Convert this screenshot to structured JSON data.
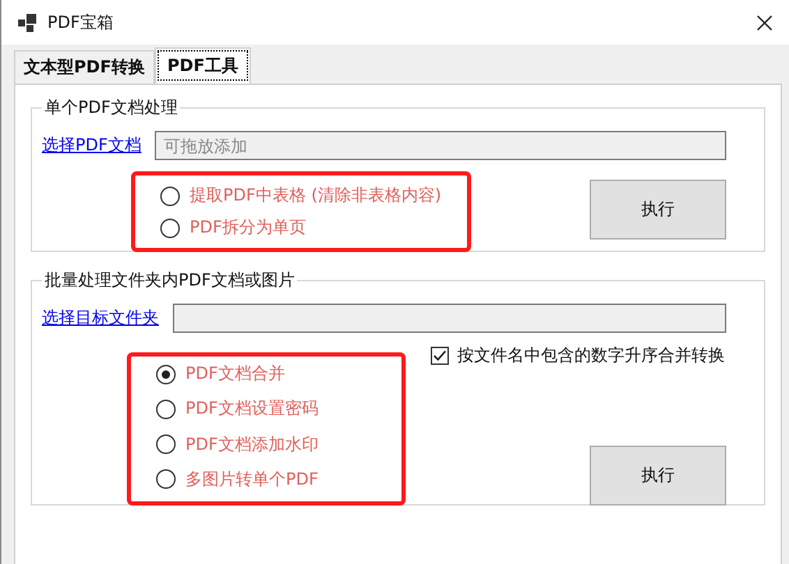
{
  "window": {
    "title": "PDF宝箱"
  },
  "tabs": [
    {
      "label": "文本型PDF转换",
      "selected": false
    },
    {
      "label": "PDF工具",
      "selected": true
    }
  ],
  "groups": [
    {
      "title": "单个PDF文档处理",
      "link": "选择PDF文档",
      "field": {
        "placeholder": "可拖放添加"
      },
      "options": [
        {
          "label": "提取PDF中表格 (清除非表格内容)",
          "selected": false
        },
        {
          "label": "PDF拆分为单页",
          "selected": false
        }
      ],
      "button": "执行"
    },
    {
      "title": "批量处理文件夹内PDF文档或图片",
      "link": "选择目标文件夹",
      "options": [
        {
          "label": "PDF文档合并",
          "selected": true
        },
        {
          "label": "PDF文档设置密码",
          "selected": false
        },
        {
          "label": "PDF文档添加水印",
          "selected": false
        },
        {
          "label": "多图片转单个PDF",
          "selected": false
        }
      ],
      "checkbox": {
        "label": "按文件名中包含的数字升序合并转换",
        "checked": true
      },
      "button": "执行"
    }
  ]
}
